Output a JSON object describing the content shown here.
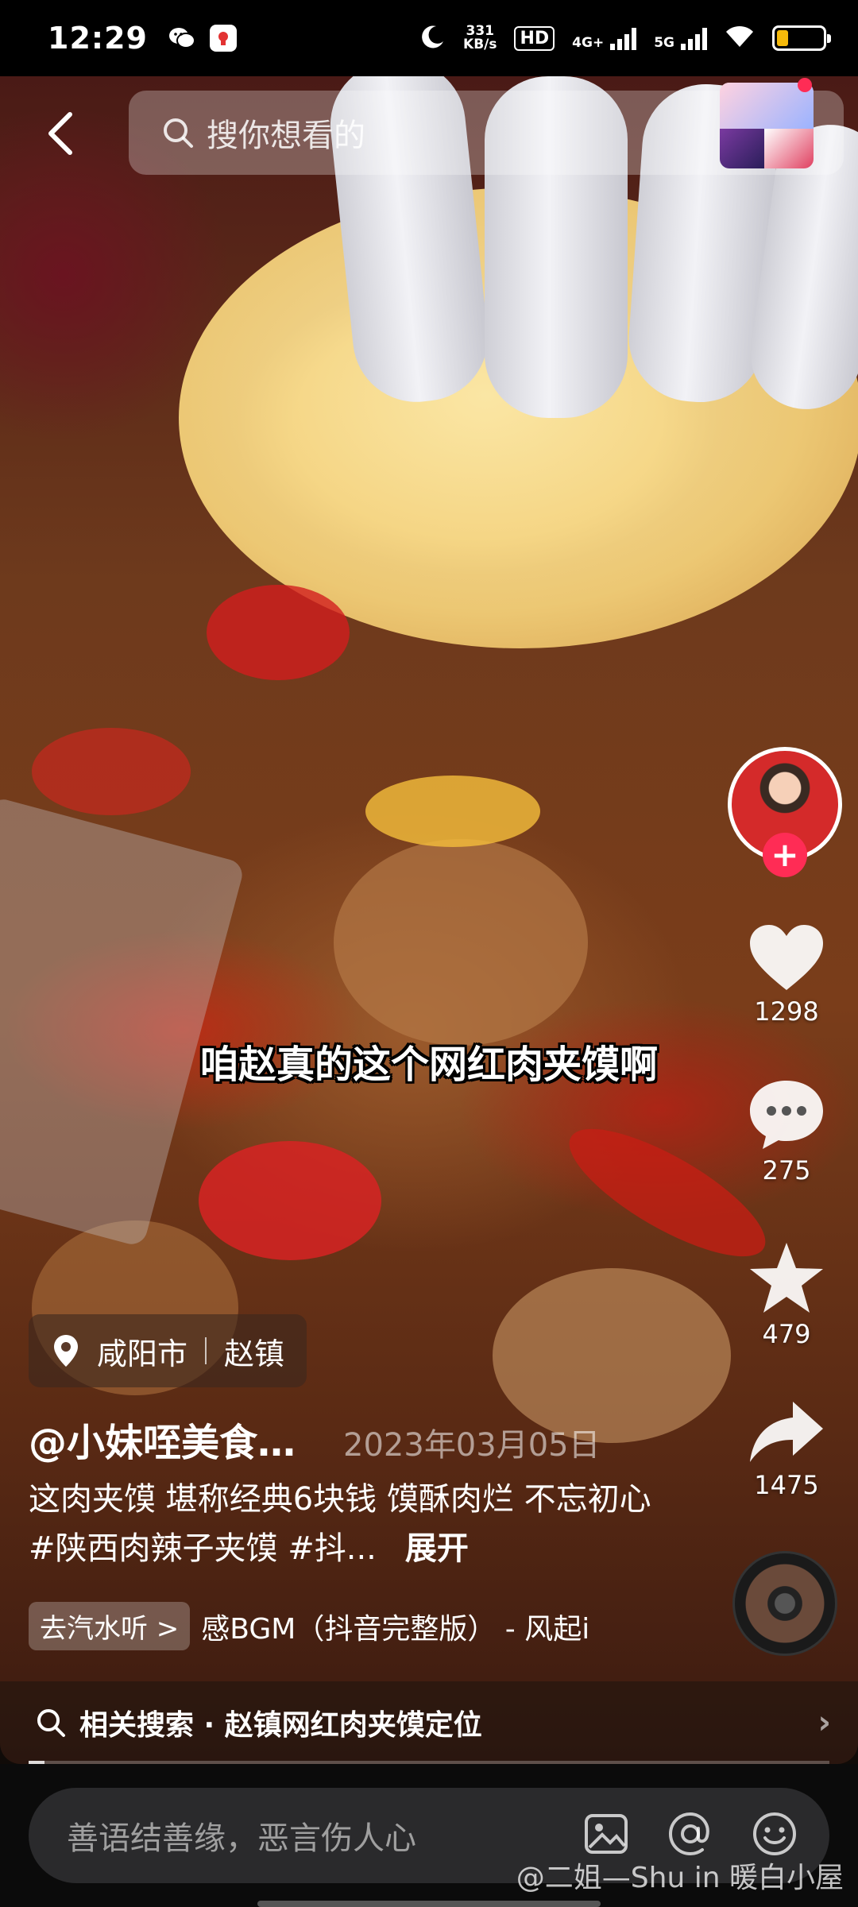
{
  "status_bar": {
    "time": "12:29",
    "net_speed_value": "331",
    "net_speed_unit": "KB/s",
    "hd_label": "HD",
    "net1": "4G+",
    "net2": "5G",
    "battery_percent": 25,
    "battery_color": "#f5b90a"
  },
  "search": {
    "placeholder": "搜你想看的"
  },
  "caption": "咱赵真的这个网红肉夹馍啊",
  "actions": {
    "likes": "1298",
    "comments": "275",
    "favorites": "479",
    "shares": "1475"
  },
  "location": {
    "city": "咸阳市",
    "place": "赵镇"
  },
  "author": "@小妹咥美食…",
  "date": "2023年03月05日",
  "description": {
    "text": "这肉夹馍 堪称经典6块钱 馍酥肉烂 不忘初心 #陕西肉辣子夹馍 #抖...",
    "expand": "展开"
  },
  "music": {
    "tag": "去汽水听 >",
    "title": "感BGM（抖音完整版） - 风起i"
  },
  "related_search": {
    "label": "相关搜索 · 赵镇网红肉夹馍定位"
  },
  "video_progress": 0.02,
  "comment_bar": {
    "placeholder": "善语结善缘，恶言伤人心"
  },
  "watermark": "@二姐—Shu in 暖白小屋",
  "colors": {
    "accent": "#ff2c55"
  }
}
